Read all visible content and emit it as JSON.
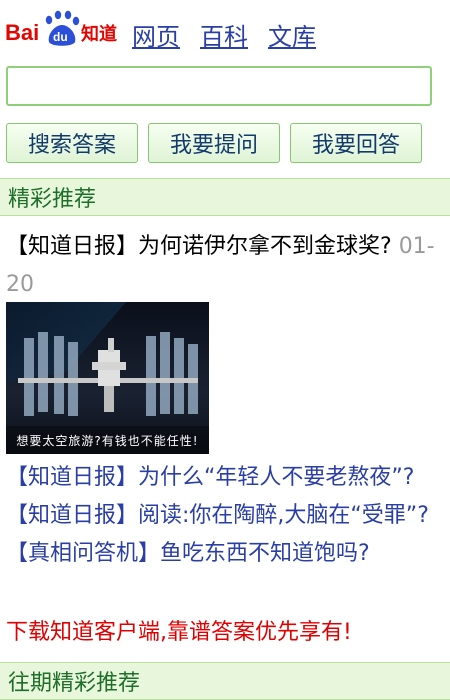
{
  "logo": {
    "text_bai": "Bai",
    "text_du": "du",
    "text_name": "知道"
  },
  "nav": {
    "items": [
      "网页",
      "百科",
      "文库"
    ]
  },
  "search": {
    "value": "",
    "placeholder": ""
  },
  "buttons": {
    "search": "搜索答案",
    "ask": "我要提问",
    "answer": "我要回答"
  },
  "sections": {
    "featured": "精彩推荐",
    "past": "往期精彩推荐"
  },
  "headline": {
    "title": "【知道日报】为何诺伊尔拿不到金球奖?",
    "date": "01-20"
  },
  "image": {
    "caption": "想要太空旅游?有钱也不能任性!"
  },
  "links": [
    "【知道日报】为什么“年轻人不要老熬夜”?",
    "【知道日报】阅读:你在陶醉,大脑在“受罪”?",
    "【真相问答机】鱼吃东西不知道饱吗?"
  ],
  "promo": "下载知道客户端,靠谱答案优先享有!",
  "colors": {
    "link": "#2a3fa6",
    "section_bg": "#e8f7dc",
    "section_text": "#1e6f2a",
    "promo": "#e00000",
    "border": "#8fd07a"
  }
}
